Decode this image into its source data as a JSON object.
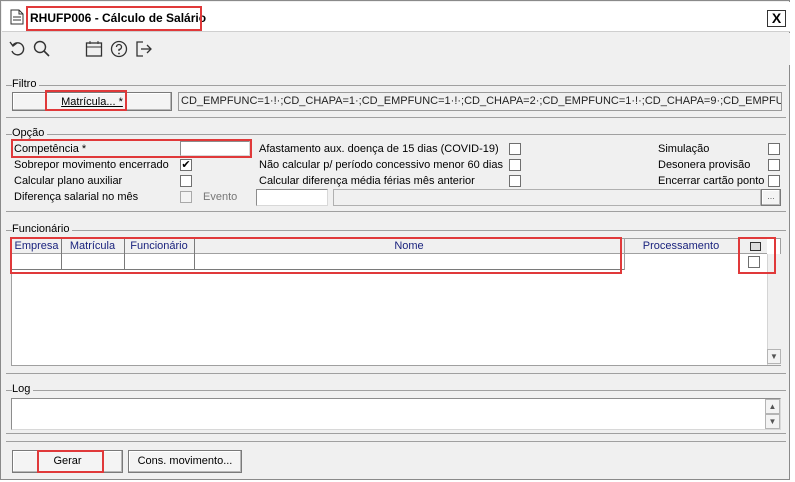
{
  "window": {
    "title": "RHUFP006 - Cálculo de Salário",
    "close": "X"
  },
  "toolbar": {
    "icons": [
      "undo-icon",
      "search-icon",
      "calendar-icon",
      "help-icon",
      "exit-icon"
    ]
  },
  "filtro": {
    "group_title": "Filtro",
    "matricula_button": "Matrícula... *",
    "filter_text": "CD_EMPFUNC=1·!·;CD_CHAPA=1·;CD_EMPFUNC=1·!·;CD_CHAPA=2·;CD_EMPFUNC=1·!·;CD_CHAPA=9·;CD_EMPFUNC=1·!·;C"
  },
  "opcao": {
    "group_title": "Opção",
    "competencia_label": "Competência *",
    "competencia_value": "",
    "sobrepor_label": "Sobrepor movimento encerrado",
    "sobrepor_checked": "✔",
    "calcular_plano_label": "Calcular plano auxiliar",
    "diferenca_label": "Diferença salarial no mês",
    "evento_label": "Evento",
    "afastamento_label": "Afastamento aux. doença de 15 dias (COVID-19)",
    "nao_calcular_label": "Não calcular p/ período concessivo menor 60 dias",
    "calcular_dif_label": "Calcular diferença média férias mês anterior",
    "simulacao_label": "Simulação",
    "desonera_label": "Desonera provisão",
    "encerrar_label": "Encerrar cartão ponto",
    "evento_button": "..."
  },
  "funcionario": {
    "group_title": "Funcionário",
    "columns": [
      "Empresa",
      "Matrícula",
      "Funcionário",
      "Nome",
      "Processamento"
    ]
  },
  "log": {
    "group_title": "Log"
  },
  "footer": {
    "gerar_button": "Gerar",
    "cons_button": "Cons. movimento..."
  }
}
